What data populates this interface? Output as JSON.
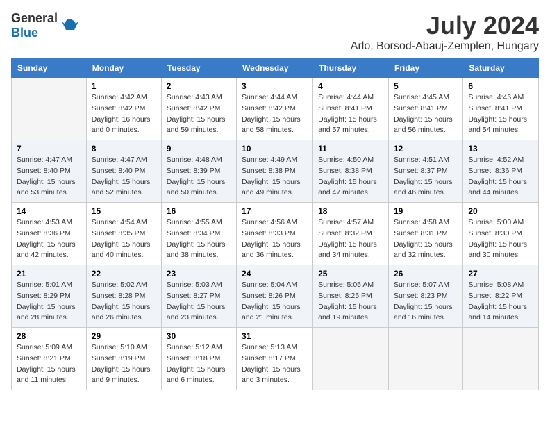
{
  "header": {
    "logo_general": "General",
    "logo_blue": "Blue",
    "month_year": "July 2024",
    "location": "Arlo, Borsod-Abauj-Zemplen, Hungary"
  },
  "days_of_week": [
    "Sunday",
    "Monday",
    "Tuesday",
    "Wednesday",
    "Thursday",
    "Friday",
    "Saturday"
  ],
  "weeks": [
    [
      {
        "day": "",
        "info": ""
      },
      {
        "day": "1",
        "info": "Sunrise: 4:42 AM\nSunset: 8:42 PM\nDaylight: 16 hours\nand 0 minutes."
      },
      {
        "day": "2",
        "info": "Sunrise: 4:43 AM\nSunset: 8:42 PM\nDaylight: 15 hours\nand 59 minutes."
      },
      {
        "day": "3",
        "info": "Sunrise: 4:44 AM\nSunset: 8:42 PM\nDaylight: 15 hours\nand 58 minutes."
      },
      {
        "day": "4",
        "info": "Sunrise: 4:44 AM\nSunset: 8:41 PM\nDaylight: 15 hours\nand 57 minutes."
      },
      {
        "day": "5",
        "info": "Sunrise: 4:45 AM\nSunset: 8:41 PM\nDaylight: 15 hours\nand 56 minutes."
      },
      {
        "day": "6",
        "info": "Sunrise: 4:46 AM\nSunset: 8:41 PM\nDaylight: 15 hours\nand 54 minutes."
      }
    ],
    [
      {
        "day": "7",
        "info": "Sunrise: 4:47 AM\nSunset: 8:40 PM\nDaylight: 15 hours\nand 53 minutes."
      },
      {
        "day": "8",
        "info": "Sunrise: 4:47 AM\nSunset: 8:40 PM\nDaylight: 15 hours\nand 52 minutes."
      },
      {
        "day": "9",
        "info": "Sunrise: 4:48 AM\nSunset: 8:39 PM\nDaylight: 15 hours\nand 50 minutes."
      },
      {
        "day": "10",
        "info": "Sunrise: 4:49 AM\nSunset: 8:38 PM\nDaylight: 15 hours\nand 49 minutes."
      },
      {
        "day": "11",
        "info": "Sunrise: 4:50 AM\nSunset: 8:38 PM\nDaylight: 15 hours\nand 47 minutes."
      },
      {
        "day": "12",
        "info": "Sunrise: 4:51 AM\nSunset: 8:37 PM\nDaylight: 15 hours\nand 46 minutes."
      },
      {
        "day": "13",
        "info": "Sunrise: 4:52 AM\nSunset: 8:36 PM\nDaylight: 15 hours\nand 44 minutes."
      }
    ],
    [
      {
        "day": "14",
        "info": "Sunrise: 4:53 AM\nSunset: 8:36 PM\nDaylight: 15 hours\nand 42 minutes."
      },
      {
        "day": "15",
        "info": "Sunrise: 4:54 AM\nSunset: 8:35 PM\nDaylight: 15 hours\nand 40 minutes."
      },
      {
        "day": "16",
        "info": "Sunrise: 4:55 AM\nSunset: 8:34 PM\nDaylight: 15 hours\nand 38 minutes."
      },
      {
        "day": "17",
        "info": "Sunrise: 4:56 AM\nSunset: 8:33 PM\nDaylight: 15 hours\nand 36 minutes."
      },
      {
        "day": "18",
        "info": "Sunrise: 4:57 AM\nSunset: 8:32 PM\nDaylight: 15 hours\nand 34 minutes."
      },
      {
        "day": "19",
        "info": "Sunrise: 4:58 AM\nSunset: 8:31 PM\nDaylight: 15 hours\nand 32 minutes."
      },
      {
        "day": "20",
        "info": "Sunrise: 5:00 AM\nSunset: 8:30 PM\nDaylight: 15 hours\nand 30 minutes."
      }
    ],
    [
      {
        "day": "21",
        "info": "Sunrise: 5:01 AM\nSunset: 8:29 PM\nDaylight: 15 hours\nand 28 minutes."
      },
      {
        "day": "22",
        "info": "Sunrise: 5:02 AM\nSunset: 8:28 PM\nDaylight: 15 hours\nand 26 minutes."
      },
      {
        "day": "23",
        "info": "Sunrise: 5:03 AM\nSunset: 8:27 PM\nDaylight: 15 hours\nand 23 minutes."
      },
      {
        "day": "24",
        "info": "Sunrise: 5:04 AM\nSunset: 8:26 PM\nDaylight: 15 hours\nand 21 minutes."
      },
      {
        "day": "25",
        "info": "Sunrise: 5:05 AM\nSunset: 8:25 PM\nDaylight: 15 hours\nand 19 minutes."
      },
      {
        "day": "26",
        "info": "Sunrise: 5:07 AM\nSunset: 8:23 PM\nDaylight: 15 hours\nand 16 minutes."
      },
      {
        "day": "27",
        "info": "Sunrise: 5:08 AM\nSunset: 8:22 PM\nDaylight: 15 hours\nand 14 minutes."
      }
    ],
    [
      {
        "day": "28",
        "info": "Sunrise: 5:09 AM\nSunset: 8:21 PM\nDaylight: 15 hours\nand 11 minutes."
      },
      {
        "day": "29",
        "info": "Sunrise: 5:10 AM\nSunset: 8:19 PM\nDaylight: 15 hours\nand 9 minutes."
      },
      {
        "day": "30",
        "info": "Sunrise: 5:12 AM\nSunset: 8:18 PM\nDaylight: 15 hours\nand 6 minutes."
      },
      {
        "day": "31",
        "info": "Sunrise: 5:13 AM\nSunset: 8:17 PM\nDaylight: 15 hours\nand 3 minutes."
      },
      {
        "day": "",
        "info": ""
      },
      {
        "day": "",
        "info": ""
      },
      {
        "day": "",
        "info": ""
      }
    ]
  ]
}
